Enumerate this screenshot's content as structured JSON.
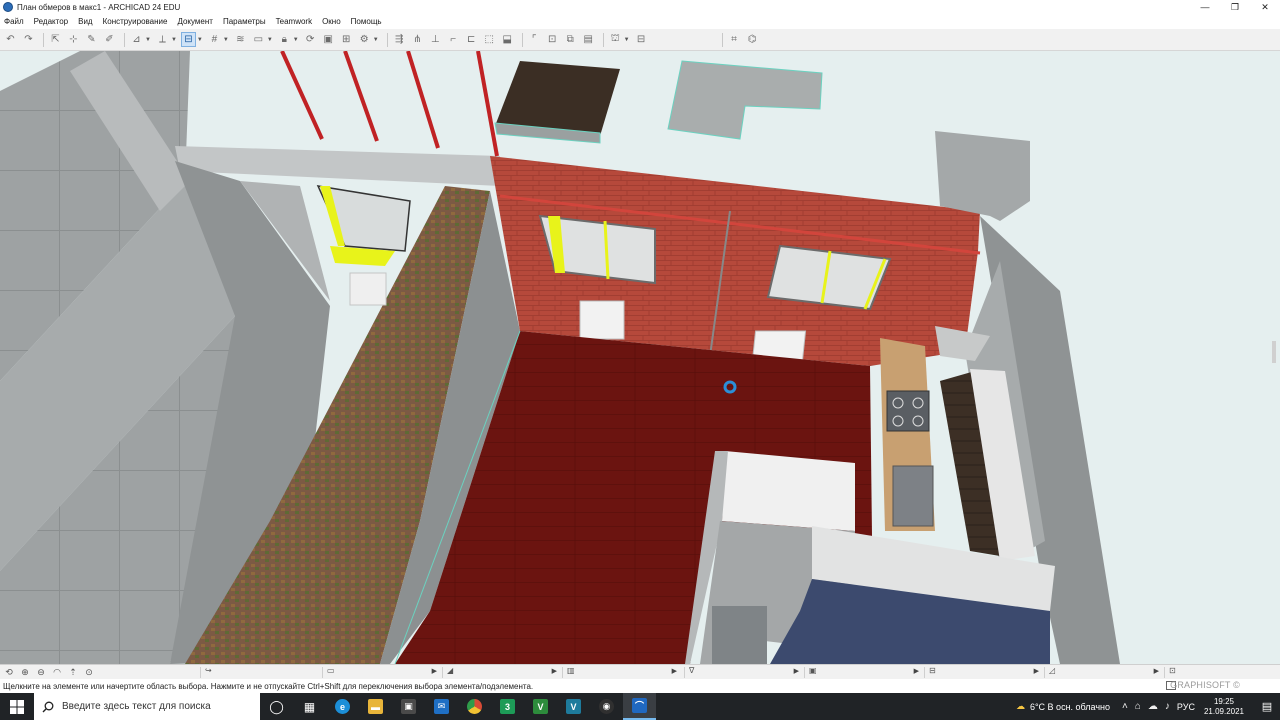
{
  "window": {
    "title": "План обмеров в макс1 - ARCHICAD 24 EDU",
    "controls": [
      "—",
      "❐",
      "✕"
    ]
  },
  "menu": [
    "Файл",
    "Редактор",
    "Вид",
    "Конструирование",
    "Документ",
    "Параметры",
    "Teamwork",
    "Окно",
    "Помощь"
  ],
  "toolbar": {
    "icons": [
      "undo-icon",
      "redo-icon",
      "arrow-select-icon",
      "marquee-icon",
      "eyedropper-icon",
      "syringe-icon",
      "angle-guide-icon",
      "snap-icon",
      "suspend-groups-icon",
      "grid-snap-icon",
      "trace-icon",
      "layers-icon",
      "lock-icon",
      "teamwork-reserve-icon",
      "view-3d-icon",
      "filter-icon",
      "pick-up-icon",
      "align-icon",
      "distribute-icon",
      "offset-icon",
      "fillet-icon",
      "split-icon",
      "adjust-icon",
      "elevate-icon",
      "drag-icon",
      "rotate-icon",
      "mirror-icon",
      "solid-ops-icon",
      "renovation-icon",
      "markup-icon",
      "library-icon"
    ]
  },
  "viewport": {
    "background": "#e5efef",
    "colors": {
      "concrete": "#9ea2a3",
      "brick": "#b24a3c",
      "floor": "#6e1510",
      "window_frame": "#e8f31a",
      "pipe": "#c02224",
      "cursor": "#2b8fd8"
    }
  },
  "viewbar": {
    "icons": [
      "rotate-view-icon",
      "zoom-in-icon",
      "zoom-out-icon",
      "orbit-icon",
      "walk-icon",
      "fit-icon"
    ]
  },
  "status": {
    "hint": "Щелкните на элементе или начертите область выбора. Нажмите и не отпускайте Ctrl+Shift для переключения выбора элемента/подэлемента.",
    "brand": "GRAPHISOFT ©"
  },
  "taskbar": {
    "search_placeholder": "Введите здесь текст для поиска",
    "apps": [
      {
        "name": "task-view",
        "glyph": "◯",
        "color": "#202326"
      },
      {
        "name": "widgets",
        "glyph": "▦",
        "color": "#202326"
      },
      {
        "name": "edge",
        "glyph": "e",
        "color": "#1c8fd8"
      },
      {
        "name": "explorer",
        "glyph": "▬",
        "color": "#e8b53a"
      },
      {
        "name": "store",
        "glyph": "▣",
        "color": "#4a4a4a"
      },
      {
        "name": "mail",
        "glyph": "✉",
        "color": "#1f6fc4"
      },
      {
        "name": "chrome",
        "glyph": "●",
        "color": "#d84b36"
      },
      {
        "name": "sketchup",
        "glyph": "3",
        "color": "#1d9b57"
      },
      {
        "name": "revit",
        "glyph": "V",
        "color": "#2d8c3c"
      },
      {
        "name": "archicad-green",
        "glyph": "V",
        "color": "#1e7b9c"
      },
      {
        "name": "obs",
        "glyph": "◉",
        "color": "#303030"
      },
      {
        "name": "archicad",
        "glyph": "⌒",
        "color": "#2068c0"
      }
    ],
    "weather": "6°C  В осн. облачно",
    "language": "РУС",
    "time": "19:25",
    "date": "21.09.2021"
  }
}
